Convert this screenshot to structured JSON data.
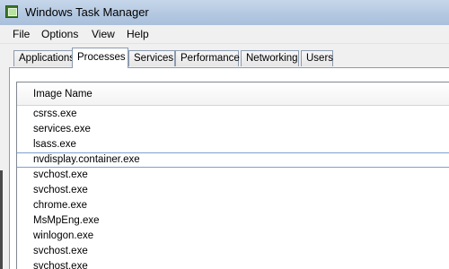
{
  "window": {
    "title": "Windows Task Manager",
    "icon": "task-manager-icon"
  },
  "menu": {
    "items": [
      "File",
      "Options",
      "View",
      "Help"
    ]
  },
  "tabs": {
    "items": [
      "Applications",
      "Processes",
      "Services",
      "Performance",
      "Networking",
      "Users"
    ],
    "selected": "Processes"
  },
  "processes": {
    "column_header": "Image Name",
    "rows": [
      "csrss.exe",
      "services.exe",
      "lsass.exe",
      "nvdisplay.container.exe",
      "svchost.exe",
      "svchost.exe",
      "chrome.exe",
      "MsMpEng.exe",
      "winlogon.exe",
      "svchost.exe",
      "svchost.exe"
    ],
    "focused_row": "nvdisplay.container.exe"
  },
  "colors": {
    "titlebar": "#b4c8e1",
    "tab_border": "#8b9bb0",
    "focus_border": "#7da2ce"
  }
}
